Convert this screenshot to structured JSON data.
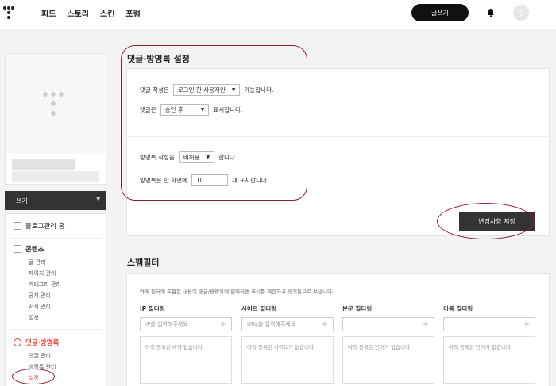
{
  "topbar": {
    "nav": [
      "피드",
      "스토리",
      "스킨",
      "포럼"
    ],
    "write_button": "글쓰기"
  },
  "sidebar": {
    "write_label": "쓰기",
    "menu": {
      "blog_home": "블로그관리 홈",
      "contents": "콘텐츠",
      "contents_items": [
        "글 관리",
        "페이지 관리",
        "카테고리 관리",
        "공지 관리",
        "서식 관리",
        "설정"
      ],
      "comments": "댓글·방명록",
      "comments_items": [
        "댓글 관리",
        "방명록 관리",
        "설정"
      ]
    }
  },
  "settings": {
    "title": "댓글·방명록 설정",
    "comment_write_prefix": "댓글 작성은",
    "comment_write_value": "로그인 한 사용자만",
    "comment_write_suffix": "가능합니다.",
    "comment_approve_prefix": "댓글은",
    "comment_approve_value": "승인 후",
    "comment_approve_suffix": "표시합니다.",
    "guestbook_write_prefix": "방명록 작성을",
    "guestbook_write_value": "비허용",
    "guestbook_write_suffix": "합니다.",
    "guestbook_count_prefix": "방명록은 한 화면에",
    "guestbook_count_value": "10",
    "guestbook_count_suffix": "개 표시합니다.",
    "save_button": "변경사항 저장"
  },
  "spam": {
    "title": "스팸필터",
    "description": "아래 필터에 포함된 내용이 댓글/방명록에 입력되면 표시를 제한하고 휴지통으로 보냅니다.",
    "filters": [
      {
        "label": "IP 필터링",
        "placeholder": "IP를 입력해주세요",
        "empty": "아직 등록된 IP가 없습니다."
      },
      {
        "label": "사이트 필터링",
        "placeholder": "URL을 입력해주세요",
        "empty": "아직 등록된 사이트가 없습니다."
      },
      {
        "label": "본문 필터링",
        "placeholder": "",
        "empty": "아직 등록된 단어가 없습니다."
      },
      {
        "label": "이름 필터링",
        "placeholder": "",
        "empty": "아직 등록된 단어가 없습니다."
      }
    ]
  },
  "colors": {
    "accent_red": "#e2493e",
    "annotation": "#8a1f2e",
    "dark_button": "#333333"
  }
}
